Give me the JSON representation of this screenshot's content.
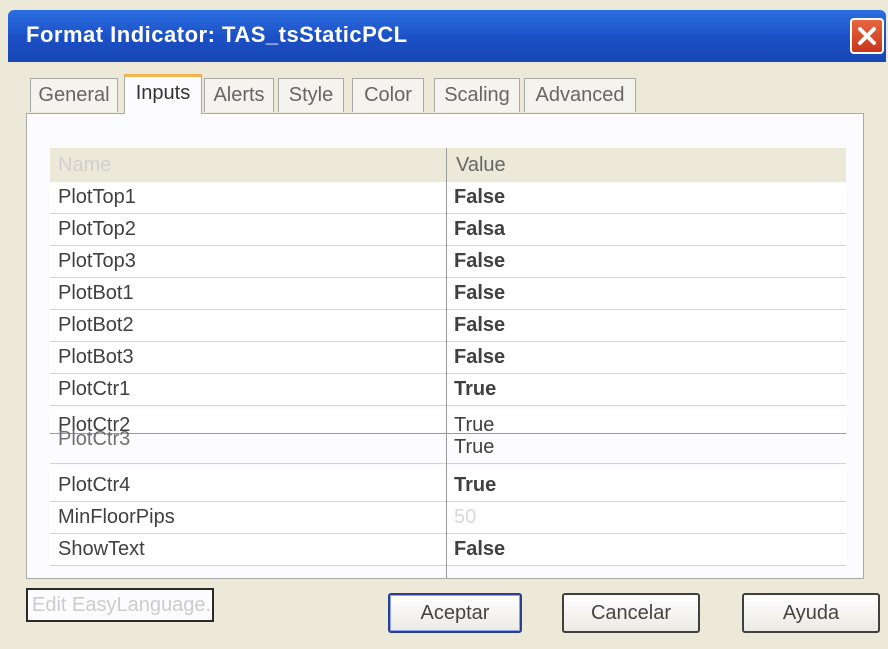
{
  "window": {
    "title": "Format Indicator: TAS_tsStaticPCL"
  },
  "tabs": [
    {
      "label": "General",
      "active": false
    },
    {
      "label": "Inputs",
      "active": true
    },
    {
      "label": "Alerts",
      "active": false
    },
    {
      "label": "Style",
      "active": false
    },
    {
      "label": "Color",
      "active": false
    },
    {
      "label": "Scaling",
      "active": false
    },
    {
      "label": "Advanced",
      "active": false
    }
  ],
  "grid": {
    "headers": {
      "name": "Name",
      "value": "Value"
    },
    "rows": [
      {
        "name": "PlotTop1",
        "value": "False"
      },
      {
        "name": "PlotTop2",
        "value": "Falsa"
      },
      {
        "name": "PlotTop3",
        "value": "False"
      },
      {
        "name": "PlotBot1",
        "value": "False"
      },
      {
        "name": "PlotBot2",
        "value": "False"
      },
      {
        "name": "PlotBot3",
        "value": "False"
      },
      {
        "name": "PlotCtr1",
        "value": "True"
      },
      {
        "name": "PlotCtr2",
        "value": "True"
      },
      {
        "name": "PlotCtr3",
        "value": "True"
      },
      {
        "name": "PlotCtr4",
        "value": "True"
      },
      {
        "name": "MinFloorPips",
        "value": "50"
      },
      {
        "name": "ShowText",
        "value": "False"
      }
    ]
  },
  "buttons": {
    "edit_easylanguage": "Edit EasyLanguage...",
    "accept": "Aceptar",
    "cancel": "Cancelar",
    "help": "Ayuda"
  },
  "colors": {
    "titlebar": "#1b4fc4",
    "close_button": "#c9361b",
    "dialog_bg": "#ece9d8",
    "active_tab_accent": "#f2b44b"
  }
}
